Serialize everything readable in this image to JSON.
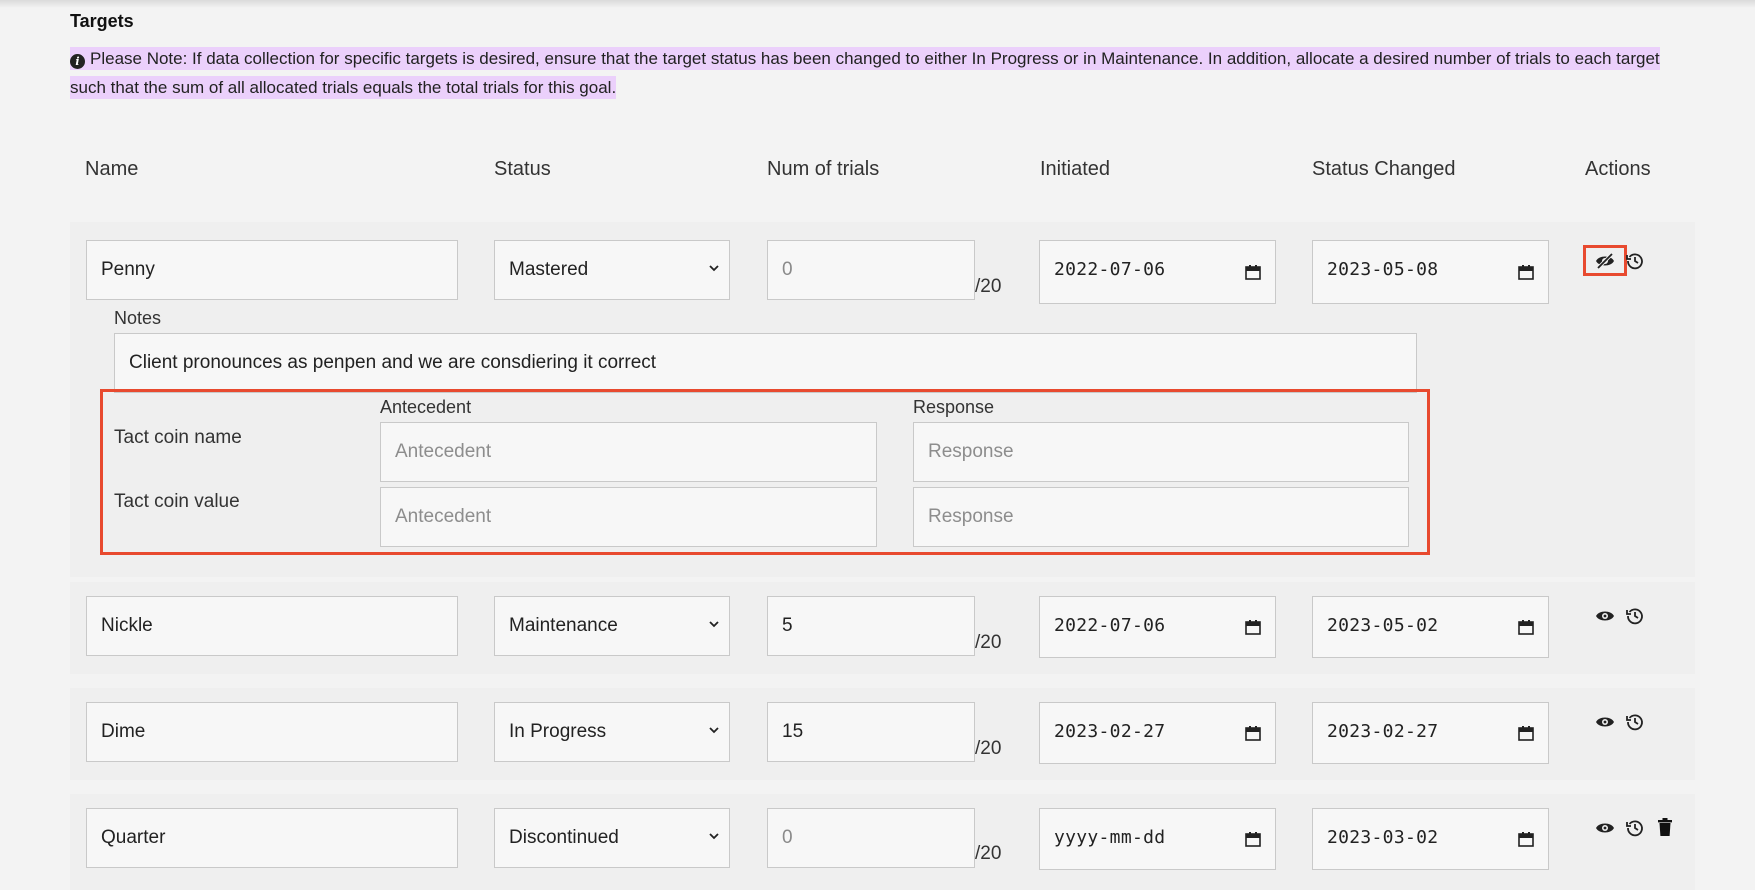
{
  "section": {
    "title": "Targets",
    "note": "Please Note: If data collection for specific targets is desired, ensure that the target status has been changed to either In Progress or in Maintenance. In addition, allocate a desired number of trials to each target such that the sum of all allocated trials equals the total trials for this goal."
  },
  "columns": {
    "name": "Name",
    "status": "Status",
    "trials": "Num of trials",
    "initiated": "Initiated",
    "status_changed": "Status Changed",
    "actions": "Actions"
  },
  "rows": [
    {
      "name": "Penny",
      "status": "Mastered",
      "trials": "0",
      "total": "/20",
      "initiated": "2022-07-06",
      "status_changed": "2023-05-08"
    },
    {
      "name": "Nickle",
      "status": "Maintenance",
      "trials": "5",
      "total": "/20",
      "initiated": "2022-07-06",
      "status_changed": "2023-05-02"
    },
    {
      "name": "Dime",
      "status": "In Progress",
      "trials": "15",
      "total": "/20",
      "initiated": "2023-02-27",
      "status_changed": "2023-02-27"
    },
    {
      "name": "Quarter",
      "status": "Discontinued",
      "trials": "0",
      "total": "/20",
      "initiated": "yyyy-mm-dd",
      "status_changed": "2023-03-02"
    }
  ],
  "expanded": {
    "notes_label": "Notes",
    "notes_value": "Client pronounces as penpen and we are consdiering it correct",
    "antecedent_label": "Antecedent",
    "response_label": "Response",
    "antecedent_placeholder": "Antecedent",
    "response_placeholder": "Response",
    "sub_targets": [
      "Tact coin name",
      "Tact coin value"
    ]
  },
  "colors": {
    "highlight": "#e84a2f",
    "note_bg": "#ebd0fb",
    "page_bg": "#f3f3f3"
  },
  "icons": [
    "info-icon",
    "eye-slash-icon",
    "eye-icon",
    "history-icon",
    "trash-icon",
    "chevron-down-icon",
    "calendar-icon"
  ]
}
